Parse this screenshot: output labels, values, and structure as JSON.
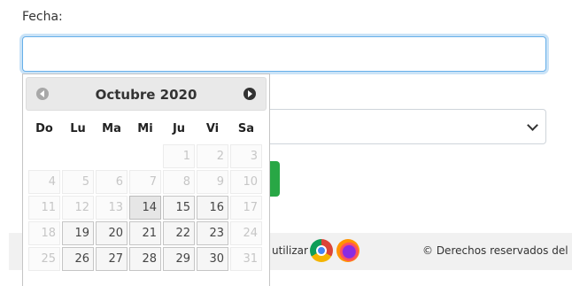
{
  "form": {
    "fecha_label": "Fecha:",
    "fecha_value": "",
    "fecha_placeholder": ""
  },
  "datepicker": {
    "title": "Octubre 2020",
    "weekdays": [
      "Do",
      "Lu",
      "Ma",
      "Mi",
      "Ju",
      "Vi",
      "Sa"
    ],
    "weeks": [
      [
        null,
        null,
        null,
        null,
        {
          "d": "1",
          "on": false
        },
        {
          "d": "2",
          "on": false
        },
        {
          "d": "3",
          "on": false
        }
      ],
      [
        {
          "d": "4",
          "on": false
        },
        {
          "d": "5",
          "on": false
        },
        {
          "d": "6",
          "on": false
        },
        {
          "d": "7",
          "on": false
        },
        {
          "d": "8",
          "on": false
        },
        {
          "d": "9",
          "on": false
        },
        {
          "d": "10",
          "on": false
        }
      ],
      [
        {
          "d": "11",
          "on": false
        },
        {
          "d": "12",
          "on": false
        },
        {
          "d": "13",
          "on": false
        },
        {
          "d": "14",
          "on": true,
          "today": true
        },
        {
          "d": "15",
          "on": true
        },
        {
          "d": "16",
          "on": true
        },
        {
          "d": "17",
          "on": false
        }
      ],
      [
        {
          "d": "18",
          "on": false
        },
        {
          "d": "19",
          "on": true
        },
        {
          "d": "20",
          "on": true
        },
        {
          "d": "21",
          "on": true
        },
        {
          "d": "22",
          "on": true
        },
        {
          "d": "23",
          "on": true
        },
        {
          "d": "24",
          "on": false
        }
      ],
      [
        {
          "d": "25",
          "on": false
        },
        {
          "d": "26",
          "on": true
        },
        {
          "d": "27",
          "on": true
        },
        {
          "d": "28",
          "on": true
        },
        {
          "d": "29",
          "on": true
        },
        {
          "d": "30",
          "on": true
        },
        {
          "d": "31",
          "on": false
        }
      ]
    ]
  },
  "footer": {
    "use_text": "utilizar",
    "copyright": "© Derechos reservados del G"
  },
  "icons": {
    "prev": "chevron-left-circle-icon",
    "next": "chevron-right-circle-icon",
    "chrome": "chrome-icon",
    "firefox": "firefox-icon",
    "select": "chevron-down-icon"
  },
  "colors": {
    "focus_border": "#66afe9",
    "button_green": "#28a745",
    "footer_bg": "#f1f1f1",
    "header_bg": "#e9e9e9"
  }
}
